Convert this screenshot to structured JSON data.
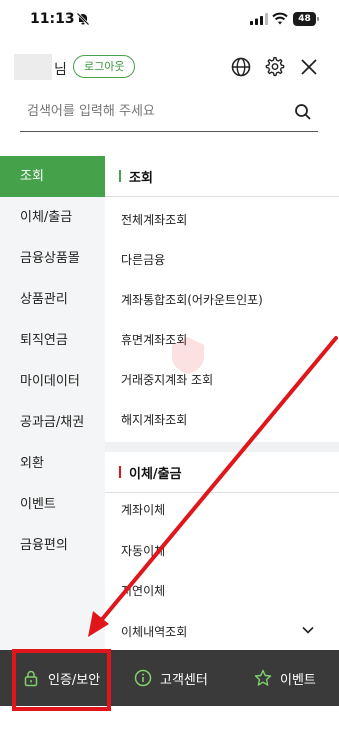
{
  "status": {
    "time": "11:13",
    "battery": "48"
  },
  "header": {
    "user_suffix": "님",
    "logout_label": "로그아웃"
  },
  "search": {
    "placeholder": "검색어를 입력해 주세요"
  },
  "sidebar": {
    "items": [
      {
        "label": "조회",
        "active": true
      },
      {
        "label": "이체/출금"
      },
      {
        "label": "금융상품몰"
      },
      {
        "label": "상품관리"
      },
      {
        "label": "퇴직연금"
      },
      {
        "label": "마이데이터"
      },
      {
        "label": "공과금/채권"
      },
      {
        "label": "외환"
      },
      {
        "label": "이벤트"
      },
      {
        "label": "금융편의"
      }
    ]
  },
  "main": {
    "sections": [
      {
        "title": "조회",
        "items": [
          "전체계좌조회",
          "다른금융",
          "계좌통합조회(어카운트인포)",
          "휴면계좌조회",
          "거래중지계좌 조회",
          "해지계좌조회"
        ]
      },
      {
        "title": "이체/출금",
        "items": [
          "계좌이체",
          "자동이체",
          "지연이체",
          "이체내역조회"
        ]
      }
    ]
  },
  "bottom_bar": {
    "items": [
      {
        "label": "인증/보안",
        "icon": "lock-icon"
      },
      {
        "label": "고객센터",
        "icon": "info-icon"
      },
      {
        "label": "이벤트",
        "icon": "star-icon"
      }
    ]
  },
  "colors": {
    "accent": "#45a24a",
    "bottom_bar": "#3a3a3a",
    "annotation": "#e0161b"
  }
}
